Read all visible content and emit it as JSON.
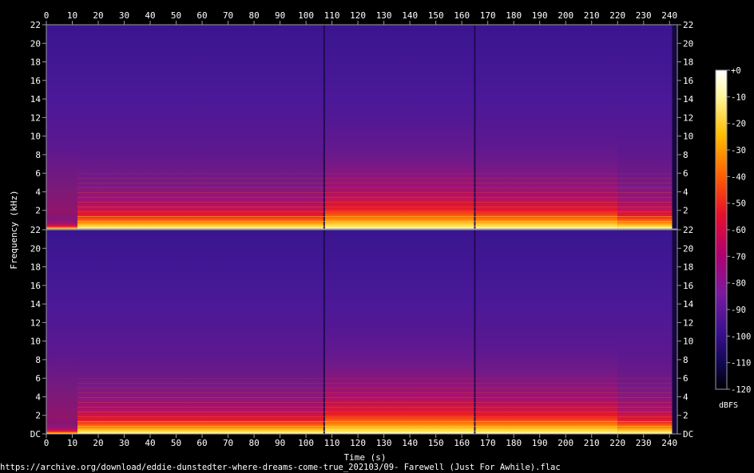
{
  "chart_data": {
    "type": "heatmap",
    "title": "",
    "xlabel": "Time (s)",
    "ylabel": "Frequency (kHz)",
    "xlim": [
      0,
      243
    ],
    "ylim": [
      0,
      22
    ],
    "x_ticks": [
      "0",
      "10",
      "20",
      "30",
      "40",
      "50",
      "60",
      "70",
      "80",
      "90",
      "100",
      "110",
      "120",
      "130",
      "140",
      "150",
      "160",
      "170",
      "180",
      "190",
      "200",
      "210",
      "220",
      "230",
      "240"
    ],
    "y_ticks_top": [
      "2",
      "4",
      "6",
      "8",
      "10",
      "12",
      "14",
      "16",
      "18",
      "20",
      "22"
    ],
    "y_ticks_bottom": [
      "DC",
      "2",
      "4",
      "6",
      "8",
      "10",
      "12",
      "14",
      "16",
      "18",
      "20",
      "22"
    ],
    "channels": 2,
    "colorbar": {
      "label": "dBFS",
      "ticks": [
        "+0",
        "-10",
        "-20",
        "-30",
        "-40",
        "-50",
        "-60",
        "-70",
        "-80",
        "-90",
        "-100",
        "-110",
        "-120"
      ],
      "range": [
        -120,
        0
      ]
    },
    "colors": {
      "background": "#000000",
      "frame": "#9a9aa6",
      "text": "#ffffff"
    },
    "footer": "https://archive.org/download/eddie-dunstedter-where-dreams-come-true_202103/09- Farewell (Just For Awhile).flac"
  }
}
